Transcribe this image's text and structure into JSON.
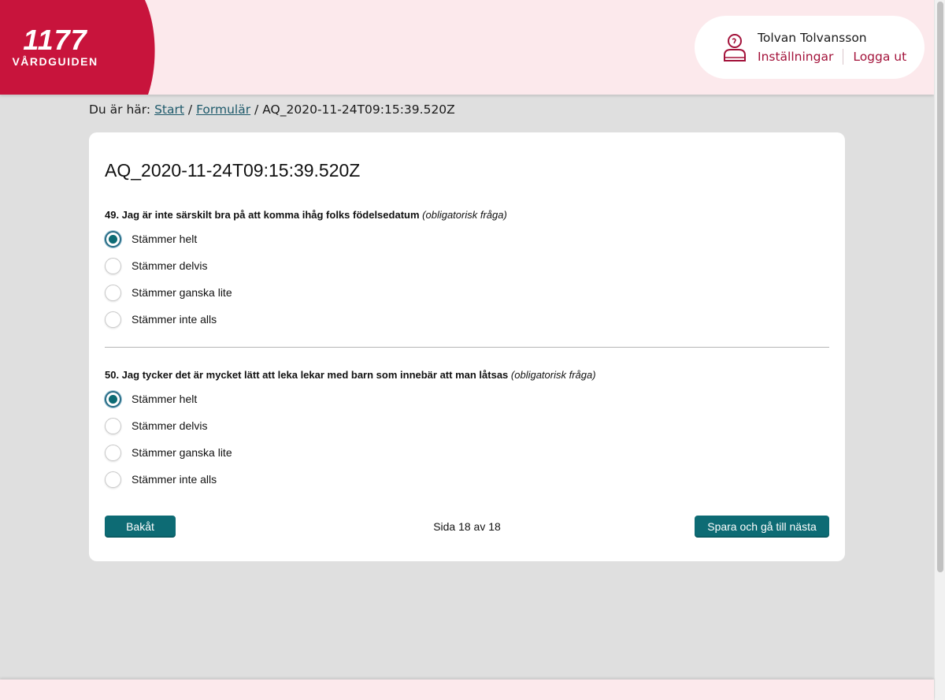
{
  "brand": {
    "number": "1177",
    "name": "VÅRDGUIDEN",
    "color": "#c8143c"
  },
  "user": {
    "name": "Tolvan Tolvansson",
    "settings_label": "Inställningar",
    "logout_label": "Logga ut",
    "icon": "user-icon"
  },
  "breadcrumb": {
    "prefix": "Du är här:",
    "items": [
      "Start",
      "Formulär"
    ],
    "current": "AQ_2020-11-24T09:15:39.520Z",
    "separator": "/"
  },
  "form": {
    "title": "AQ_2020-11-24T09:15:39.520Z",
    "questions": [
      {
        "text": "49. Jag är inte särskilt bra på att komma ihåg folks födelsedatum",
        "note": "(obligatorisk fråga)",
        "options": [
          "Stämmer helt",
          "Stämmer delvis",
          "Stämmer ganska lite",
          "Stämmer inte alls"
        ],
        "selected": "Stämmer helt"
      },
      {
        "text": "50. Jag tycker det är mycket lätt att leka lekar med barn som innebär att man låtsas",
        "note": "(obligatorisk fråga)",
        "options": [
          "Stämmer helt",
          "Stämmer delvis",
          "Stämmer ganska lite",
          "Stämmer inte alls"
        ],
        "selected": "Stämmer helt"
      }
    ],
    "back_label": "Bakåt",
    "page_info": "Sida 18 av 18",
    "next_label": "Spara och gå till nästa"
  },
  "colors": {
    "header_bg": "#fce9ec",
    "accent": "#0d6b74",
    "link": "#a3123a",
    "page_bg": "#dfdfdf"
  }
}
